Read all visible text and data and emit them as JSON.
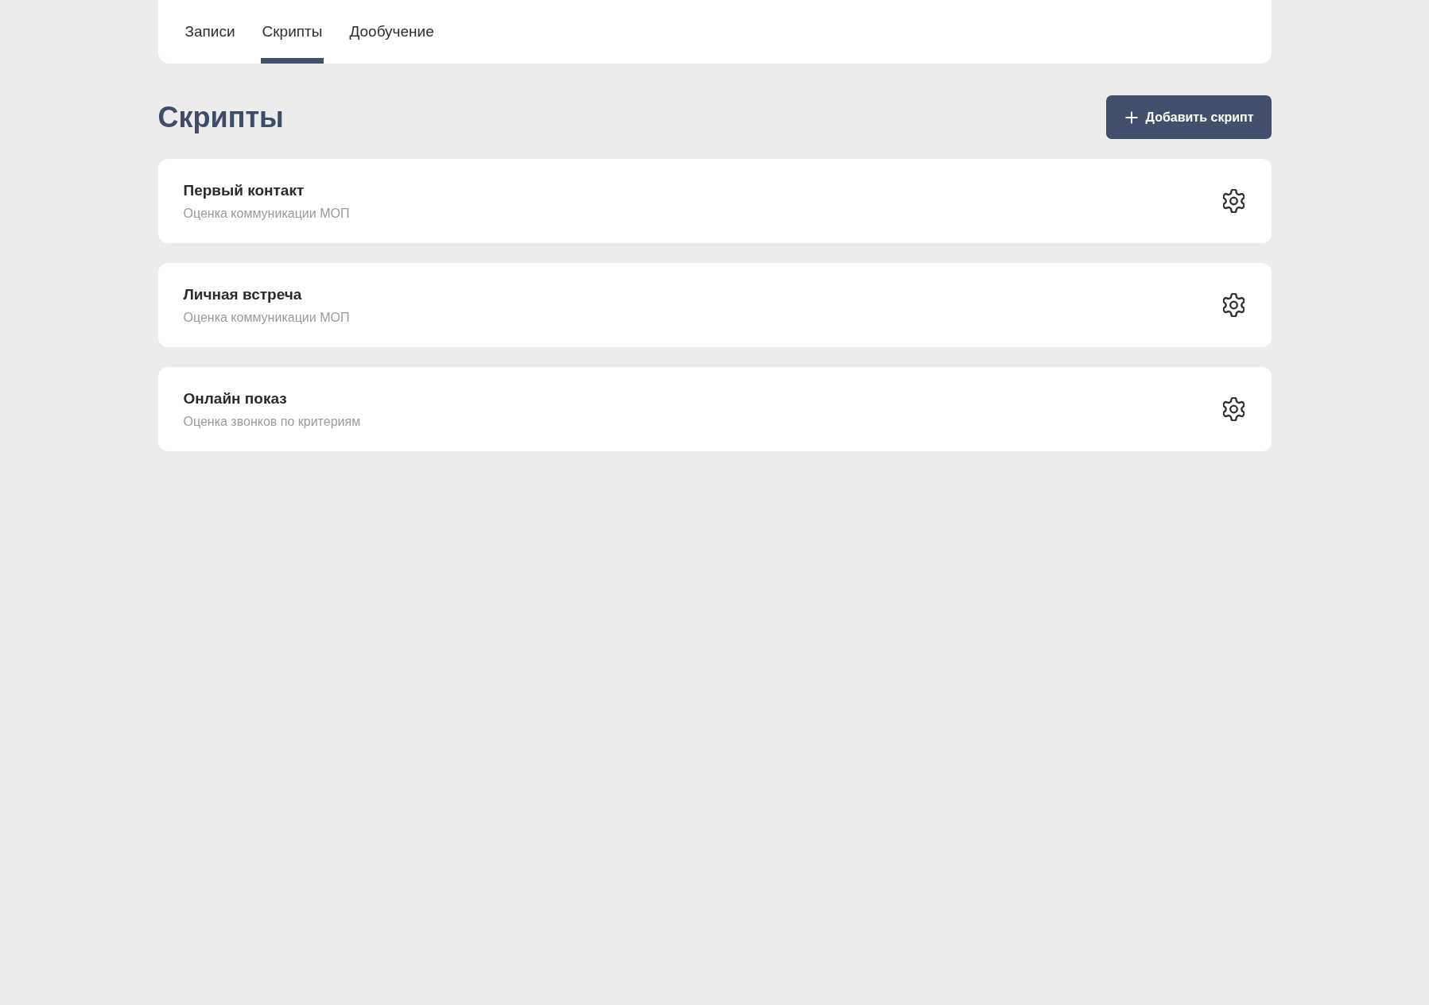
{
  "tabs": [
    {
      "label": "Записи",
      "selected": false
    },
    {
      "label": "Скрипты",
      "selected": true
    },
    {
      "label": "Дообучение",
      "selected": false
    }
  ],
  "page_title": "Скрипты",
  "add_button": {
    "label": "Добавить скрипт"
  },
  "scripts": [
    {
      "title": "Первый контакт",
      "subtitle": "Оценка коммуникации МОП"
    },
    {
      "title": "Личная встреча",
      "subtitle": "Оценка коммуникации МОП"
    },
    {
      "title": "Онлайн показ",
      "subtitle": "Оценка звонков по критериям"
    }
  ]
}
